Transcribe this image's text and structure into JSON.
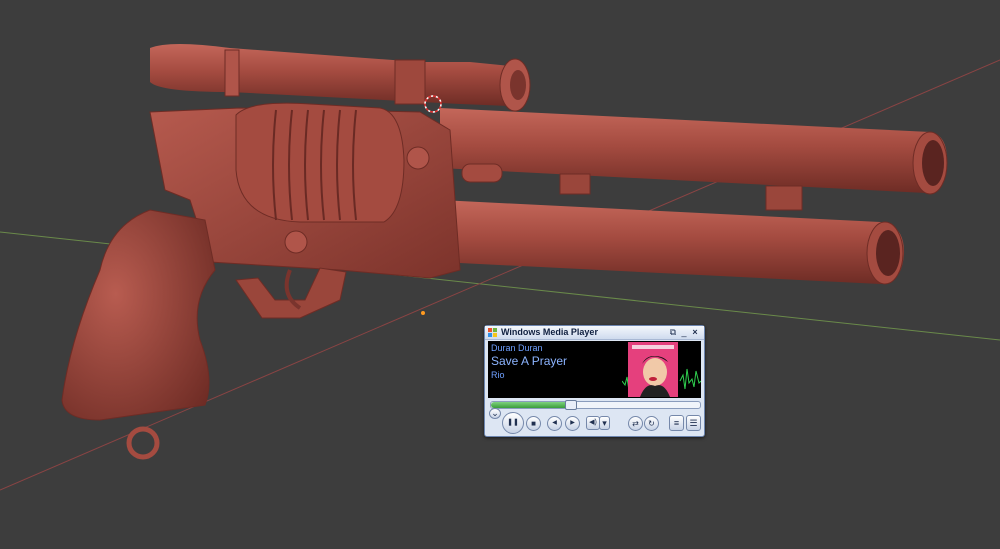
{
  "scene": {
    "background_color": "#3d3d3d",
    "model_color": "#a34a3f",
    "model": "revolver-model"
  },
  "wmp": {
    "title": "Windows Media Player",
    "artist": "Duran Duran",
    "track": "Save A Prayer",
    "album": "Rio",
    "progress": 0.38,
    "icons": [
      "switch-mode-icon",
      "minimize-icon",
      "close-icon",
      "play-pause-icon",
      "stop-icon",
      "previous-icon",
      "next-icon",
      "mute-icon",
      "volume-icon",
      "shuffle-icon",
      "repeat-icon",
      "equalizer-icon",
      "playlist-icon"
    ],
    "glyphs": {
      "switch": "⧉",
      "minimize": "_",
      "close": "×",
      "pause": "❚❚",
      "stop": "■",
      "prev": "◀",
      "next": "▶",
      "mute": "◀)",
      "vol": "▾",
      "shuffle": "⇄",
      "repeat": "↻",
      "eq": "≡",
      "playlist": "☰",
      "expand": "⌄"
    }
  }
}
